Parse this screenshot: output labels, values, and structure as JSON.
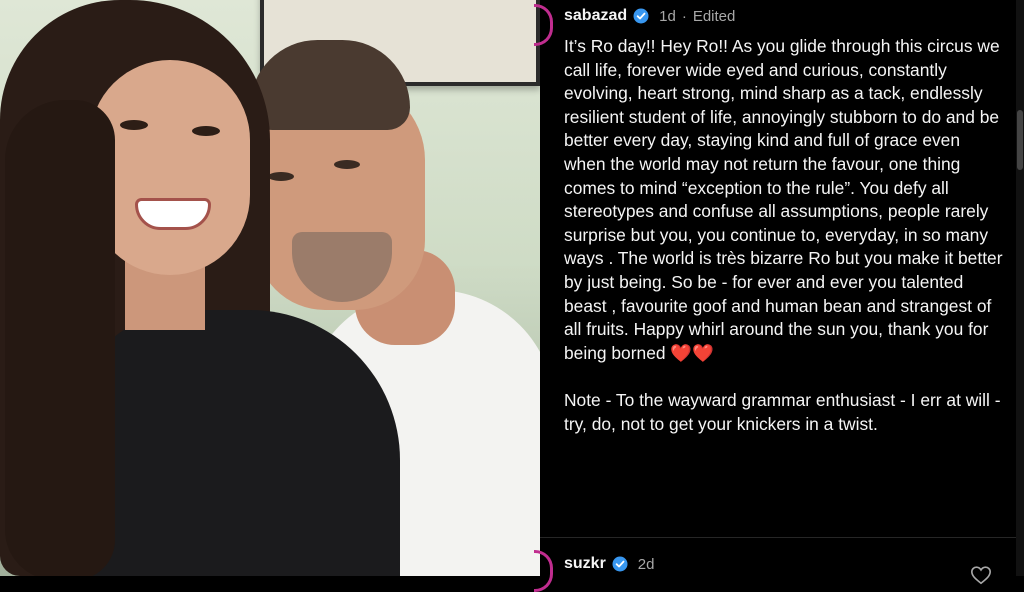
{
  "post": {
    "username": "sabazad",
    "timestamp": "1d",
    "separator": "·",
    "edited_label": "Edited",
    "caption": "It’s Ro day!! Hey Ro!! As you glide through this circus we call life, forever wide eyed and curious, constantly evolving, heart strong, mind sharp as a tack, endlessly resilient student of life, annoyingly stubborn to do and be better every day, staying kind and full of grace even when the world may not return the favour, one thing comes to mind “exception to the rule”. You defy all stereotypes and confuse all assumptions, people rarely surprise but you, you continue to, everyday, in so many ways . The world is très bizarre Ro but you make it better by just being. So be - for ever and ever you talented beast , favourite goof and human bean and strangest of all fruits. Happy whirl around the sun you, thank you for being borned ❤️❤️",
    "note": "Note - To the wayward grammar enthusiast - I err at will - try, do, not to get your knickers in a twist."
  },
  "reply": {
    "username": "suzkr",
    "timestamp": "2d"
  },
  "colors": {
    "background": "#000000",
    "text": "#f5f5f5",
    "meta": "#a8a8a8",
    "verified": "#3897f0",
    "story_ring": "#c02d8f"
  },
  "icons": {
    "verified": "verified-badge-icon",
    "like": "heart-outline-icon"
  }
}
